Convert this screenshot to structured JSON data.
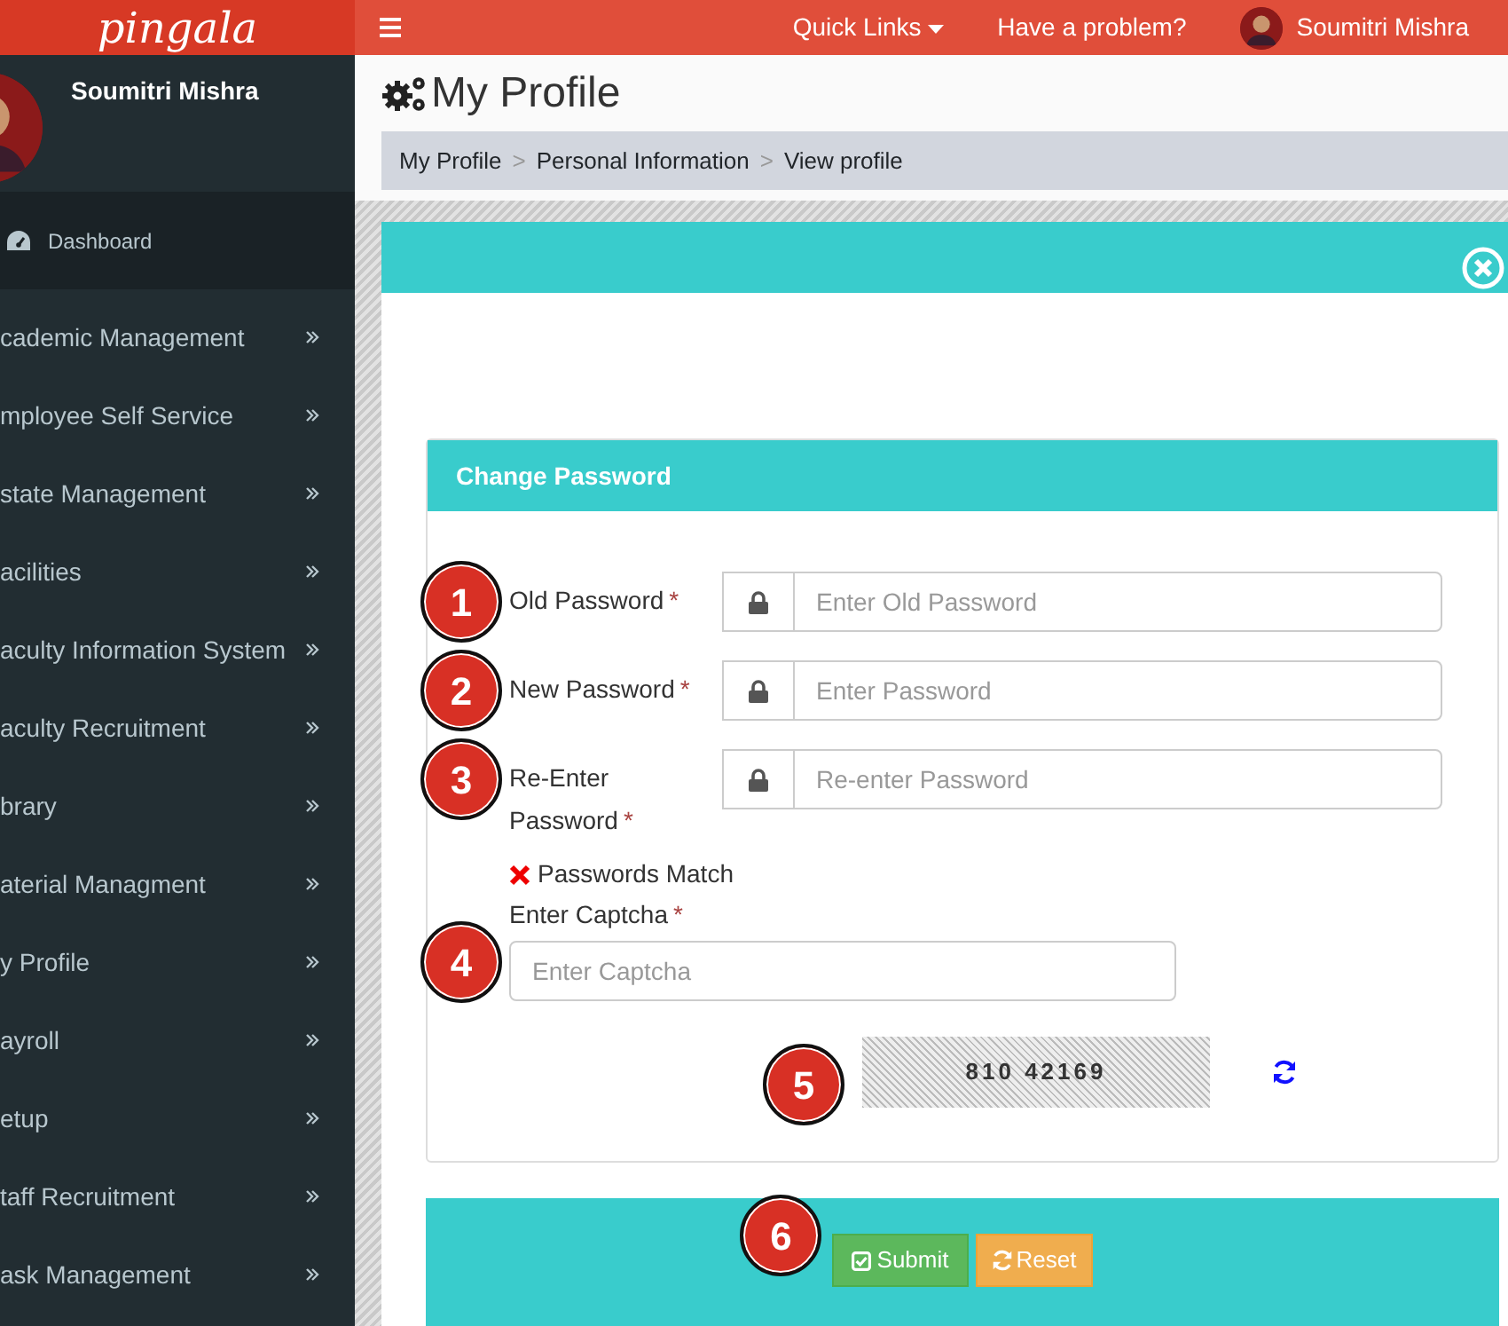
{
  "topbar": {
    "logo": "pingala",
    "links": [
      {
        "label": "Quick Links",
        "kind": "dropdown"
      },
      {
        "label": "Have a problem?",
        "kind": "link"
      }
    ],
    "user_name": "Soumitri Mishra"
  },
  "sidebar": {
    "user_name": "Soumitri Mishra",
    "items": [
      {
        "label": "Dashboard",
        "kind": "home",
        "selected": true
      },
      {
        "label": "cademic Management",
        "kind": "menu",
        "selected": false
      },
      {
        "label": "mployee Self Service",
        "kind": "menu",
        "selected": false
      },
      {
        "label": "state Management",
        "kind": "menu",
        "selected": false
      },
      {
        "label": "acilities",
        "kind": "menu",
        "selected": false
      },
      {
        "label": "aculty Information System",
        "kind": "menu",
        "selected": false
      },
      {
        "label": "aculty Recruitment",
        "kind": "menu",
        "selected": false
      },
      {
        "label": "brary",
        "kind": "menu",
        "selected": false
      },
      {
        "label": "aterial Managment",
        "kind": "menu",
        "selected": false
      },
      {
        "label": "y Profile",
        "kind": "menu",
        "selected": false
      },
      {
        "label": "ayroll",
        "kind": "menu",
        "selected": false
      },
      {
        "label": "etup",
        "kind": "menu",
        "selected": false
      },
      {
        "label": "taff Recruitment",
        "kind": "menu",
        "selected": false
      },
      {
        "label": "ask Management",
        "kind": "menu",
        "selected": false
      }
    ]
  },
  "page": {
    "title": "My Profile",
    "breadcrumb": [
      "My Profile",
      "Personal Information",
      "View profile"
    ],
    "breadcrumb_separator": ">"
  },
  "form": {
    "title": "Change Password",
    "required_mark": "*",
    "fields": [
      {
        "label": "Old Password",
        "required": true,
        "placeholder": "Enter Old Password",
        "marker": "1"
      },
      {
        "label": "New Password",
        "required": true,
        "placeholder": "Enter Password",
        "marker": "2"
      },
      {
        "label": "Re-Enter Password",
        "required": true,
        "placeholder": "Re-enter Password",
        "marker": "3"
      }
    ],
    "match_message": "Passwords Match",
    "match_ok": false,
    "captcha": {
      "label": "Enter Captcha",
      "required": true,
      "placeholder": "Enter Captcha",
      "marker": "4"
    },
    "captcha_code": "810 42169",
    "captcha_marker": "5"
  },
  "buttons": [
    {
      "label": "Submit",
      "kind": "submit",
      "marker": "6"
    },
    {
      "label": "Reset",
      "kind": "reset"
    }
  ]
}
